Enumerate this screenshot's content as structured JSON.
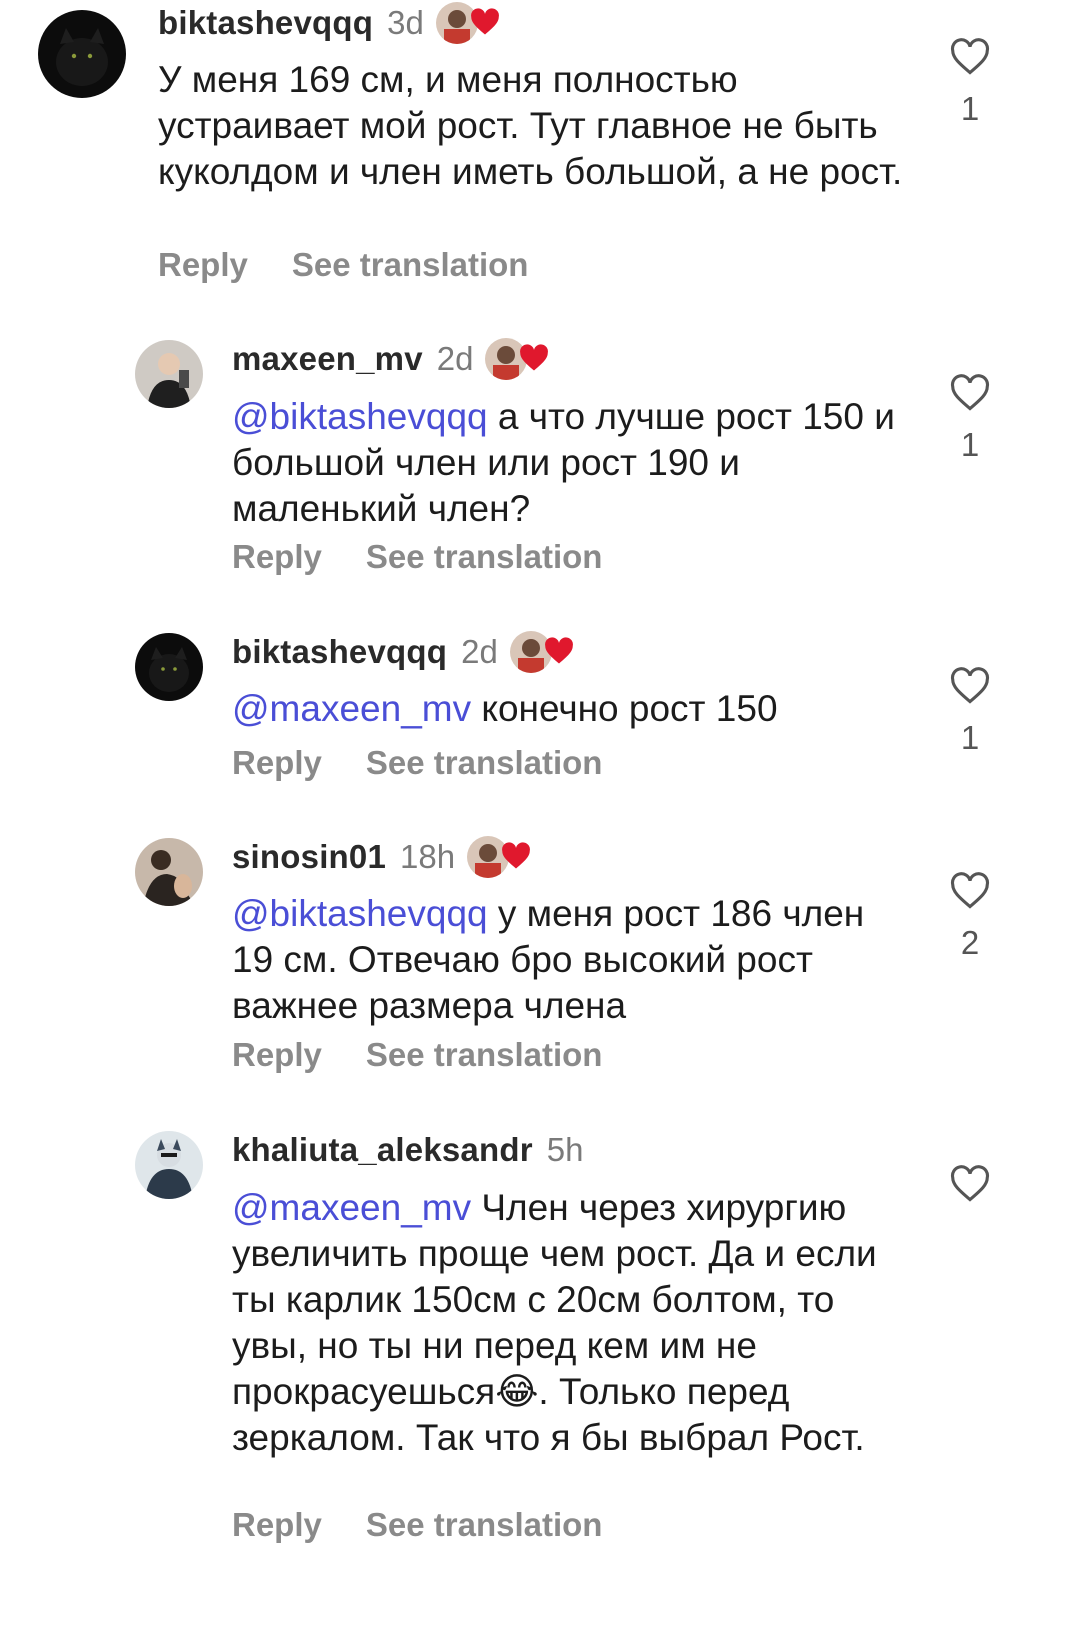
{
  "comments": [
    {
      "username": "biktashevqqq",
      "time": "3d",
      "mention": "",
      "text": "У меня 169 см, и меня полностью устраивает мой рост. Тут главное не быть куколдом и член иметь большой, а не рост.",
      "reply_label": "Reply",
      "translate_label": "See translation",
      "likes": "1",
      "liked_by_author": true
    },
    {
      "username": "maxeen_mv",
      "time": "2d",
      "mention": "@biktashevqqq",
      "text": " а что лучше рост 150 и большой член или рост 190 и маленький член?",
      "reply_label": "Reply",
      "translate_label": "See translation",
      "likes": "1",
      "liked_by_author": true
    },
    {
      "username": "biktashevqqq",
      "time": "2d",
      "mention": "@maxeen_mv",
      "text": " конечно рост 150",
      "reply_label": "Reply",
      "translate_label": "See translation",
      "likes": "1",
      "liked_by_author": true
    },
    {
      "username": "sinosin01",
      "time": "18h",
      "mention": "@biktashevqqq",
      "text": " у меня рост 186 член 19 см. Отвечаю бро  высокий рост важнее размера члена",
      "reply_label": "Reply",
      "translate_label": "See translation",
      "likes": "2",
      "liked_by_author": true
    },
    {
      "username": "khaliuta_aleksandr",
      "time": "5h",
      "mention": "@maxeen_mv",
      "text": " Член через хирургию увеличить проще чем рост. Да и если ты карлик 150см с 20см болтом, то увы, но ты ни перед кем им не прокрасуешься😂. Только перед зеркалом.  Так что я бы выбрал Рост.",
      "reply_label": "Reply",
      "translate_label": "See translation",
      "likes": "",
      "liked_by_author": false
    }
  ],
  "colors": {
    "mention": "#4a4ed6",
    "heart_red": "#e0182d",
    "muted": "#8a8a8a"
  },
  "icons": {
    "like": "heart-outline-icon",
    "creator_like": "red-heart-icon"
  }
}
